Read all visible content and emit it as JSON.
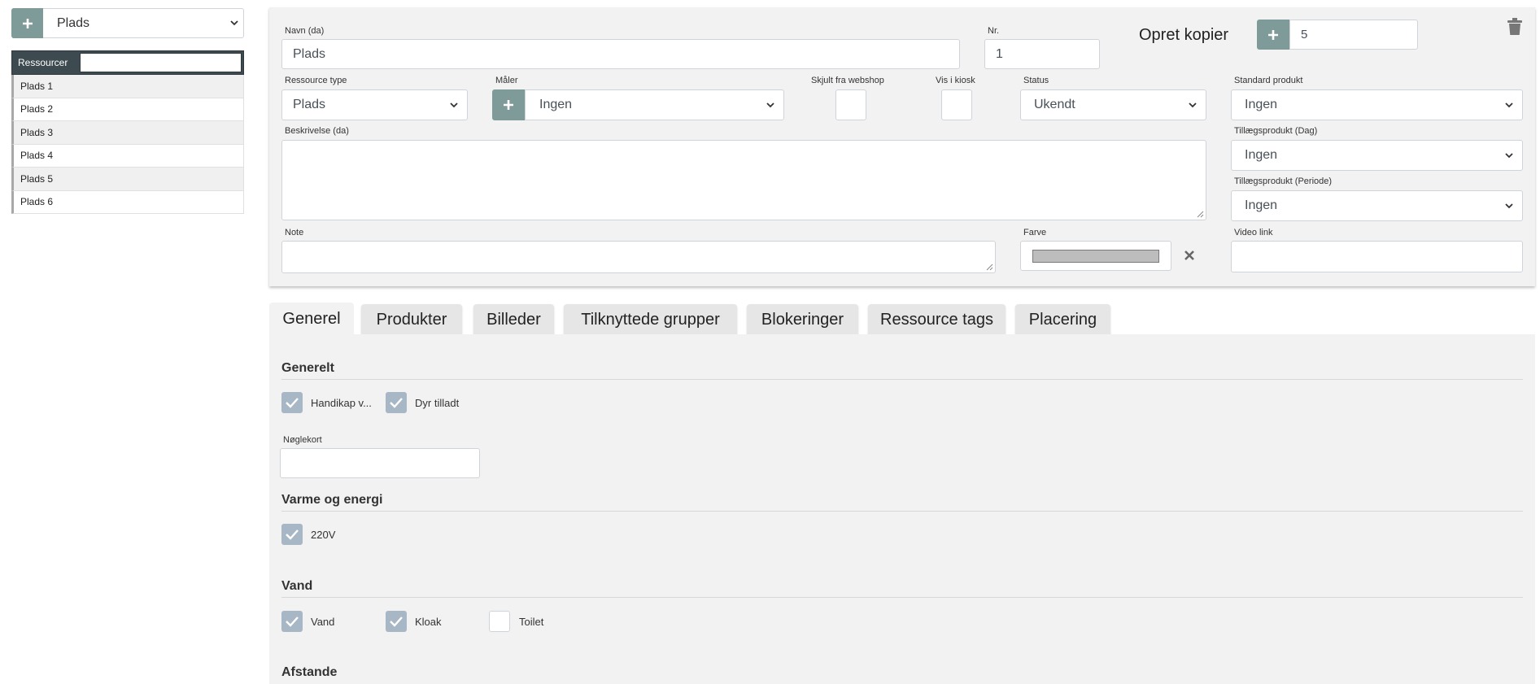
{
  "left": {
    "select_value": "Plads",
    "resources_header": "Ressourcer",
    "items": [
      "Plads 1",
      "Plads 2",
      "Plads 3",
      "Plads 4",
      "Plads 5",
      "Plads 6"
    ]
  },
  "form": {
    "navn_label": "Navn (da)",
    "navn_value": "Plads",
    "nr_label": "Nr.",
    "nr_value": "1",
    "opret_kopier_label": "Opret kopier",
    "opret_kopier_value": "5",
    "ressource_type_label": "Ressource type",
    "ressource_type_value": "Plads",
    "maler_label": "Måler",
    "maler_value": "Ingen",
    "skjult_label": "Skjult fra webshop",
    "vis_kiosk_label": "Vis i kiosk",
    "status_label": "Status",
    "status_value": "Ukendt",
    "standard_produkt_label": "Standard produkt",
    "standard_produkt_value": "Ingen",
    "beskrivelse_label": "Beskrivelse (da)",
    "tillaeg_dag_label": "Tillægsprodukt (Dag)",
    "tillaeg_dag_value": "Ingen",
    "tillaeg_periode_label": "Tillægsprodukt (Periode)",
    "tillaeg_periode_value": "Ingen",
    "note_label": "Note",
    "farve_label": "Farve",
    "farve_color": "#bdbdbd",
    "video_label": "Video link"
  },
  "tabs": [
    "Generel",
    "Produkter",
    "Billeder",
    "Tilknyttede grupper",
    "Blokeringer",
    "Ressource tags",
    "Placering"
  ],
  "general": {
    "generelt_title": "Generelt",
    "handikap_label": "Handikap v...",
    "dyr_label": "Dyr tilladt",
    "noglekort_label": "Nøglekort",
    "varme_title": "Varme og energi",
    "v220_label": "220V",
    "vand_title": "Vand",
    "vand_label": "Vand",
    "kloak_label": "Kloak",
    "toilet_label": "Toilet",
    "afstande_title": "Afstande"
  },
  "colors": {
    "accent_button": "#7f9b99",
    "checkbox_checked": "#a8b7c5",
    "header_dark": "#3d4a50"
  }
}
